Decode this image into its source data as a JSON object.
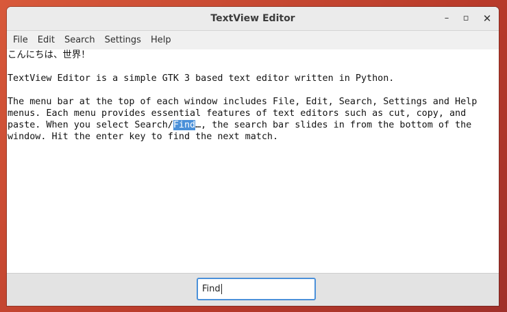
{
  "window": {
    "title": "TextView Editor",
    "controls": {
      "minimize": "–",
      "maximize": "▫",
      "close": "✕"
    }
  },
  "menubar": {
    "items": [
      "File",
      "Edit",
      "Search",
      "Settings",
      "Help"
    ]
  },
  "editor": {
    "lines": [
      "こんにちは、世界！",
      "",
      "TextView Editor is a simple GTK 3 based text editor written in Python.",
      "",
      "The menu bar at the top of each window includes File, Edit, Search, Settings and Help",
      "menus. Each menu provides essential features of text editors such as cut, copy, and"
    ],
    "line7_before": "paste. When you select Search/",
    "line7_selected": "Find",
    "line7_after": "…, the search bar slides in from the bottom of the",
    "line8": "window. Hit the enter key to find the next match."
  },
  "search": {
    "value": "Find"
  },
  "colors": {
    "selection": "#4a90d9",
    "focus_border": "#4a90d9"
  }
}
